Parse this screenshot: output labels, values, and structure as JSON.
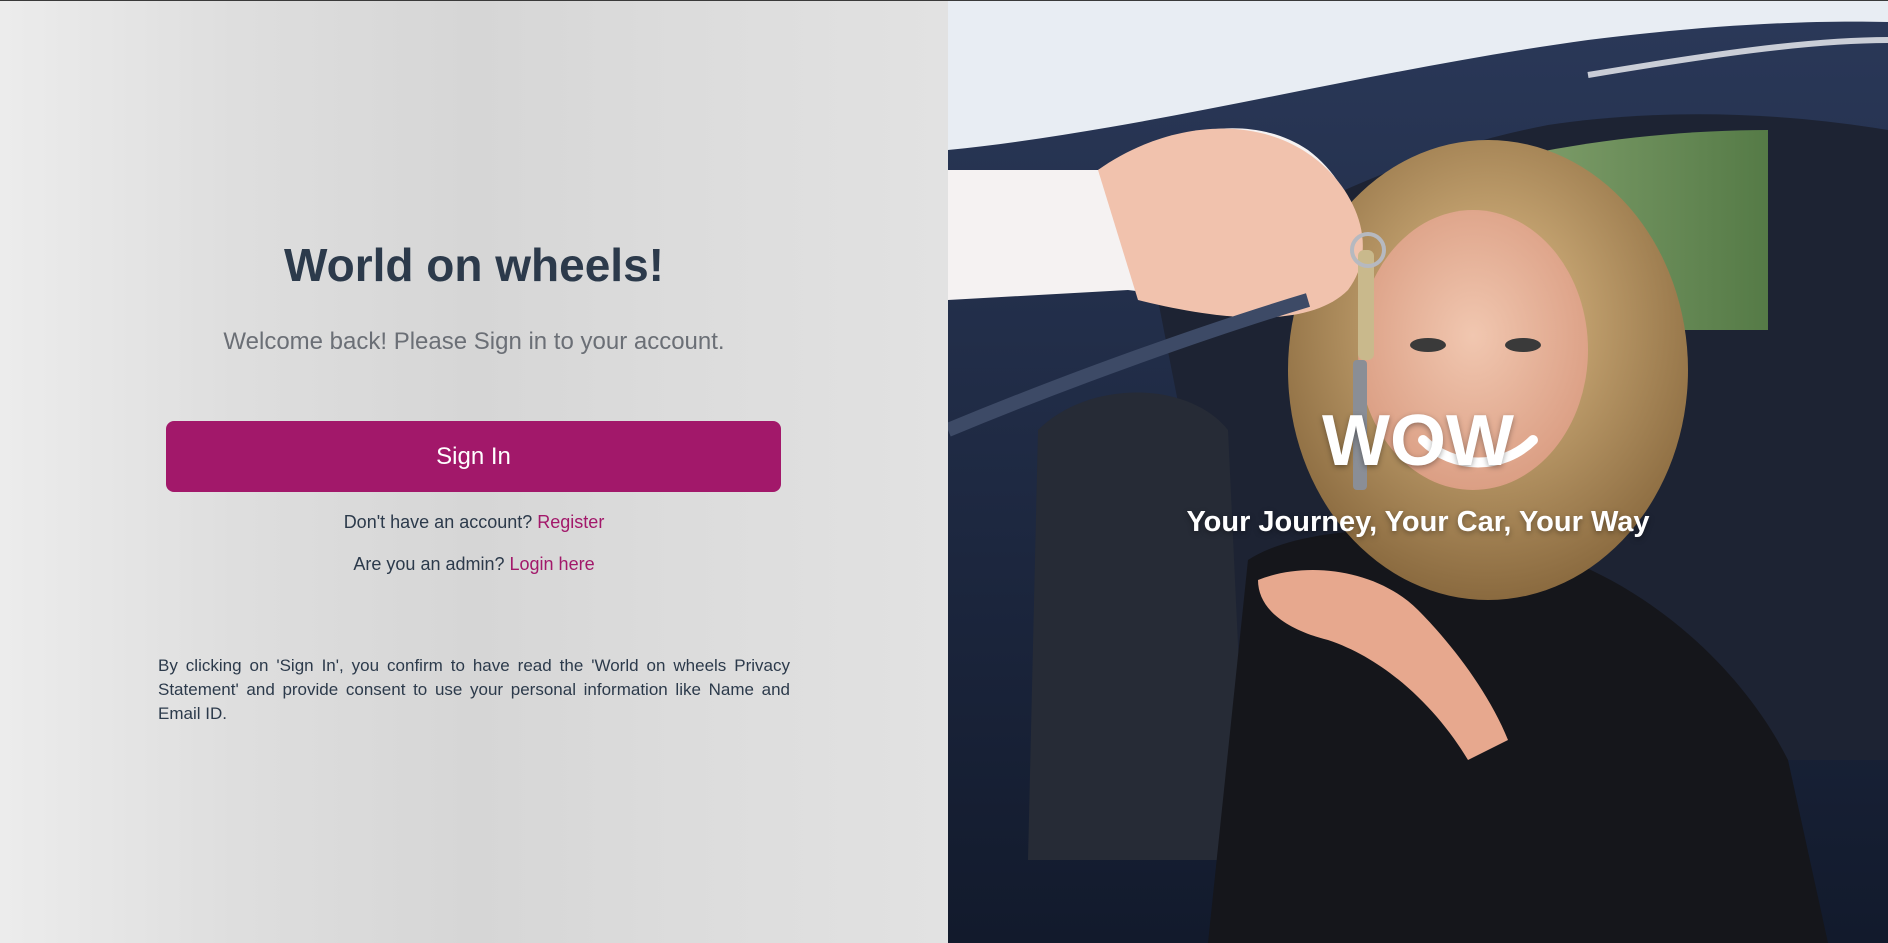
{
  "login": {
    "title": "World on wheels!",
    "subtitle": "Welcome back! Please Sign in to your account.",
    "signin_label": "Sign In",
    "register_prompt": "Don't have an account?",
    "register_link": "Register",
    "admin_prompt": "Are you an admin?",
    "admin_link": "Login here",
    "legal": "By clicking on 'Sign In', you confirm to have read the 'World on wheels Privacy Statement' and provide consent to use your personal information like Name and Email ID."
  },
  "hero": {
    "brand": "WOW",
    "tagline": "Your Journey, Your Car, Your Way"
  },
  "colors": {
    "accent": "#a2186a",
    "heading": "#2c3a4b",
    "muted": "#6b6f76"
  }
}
